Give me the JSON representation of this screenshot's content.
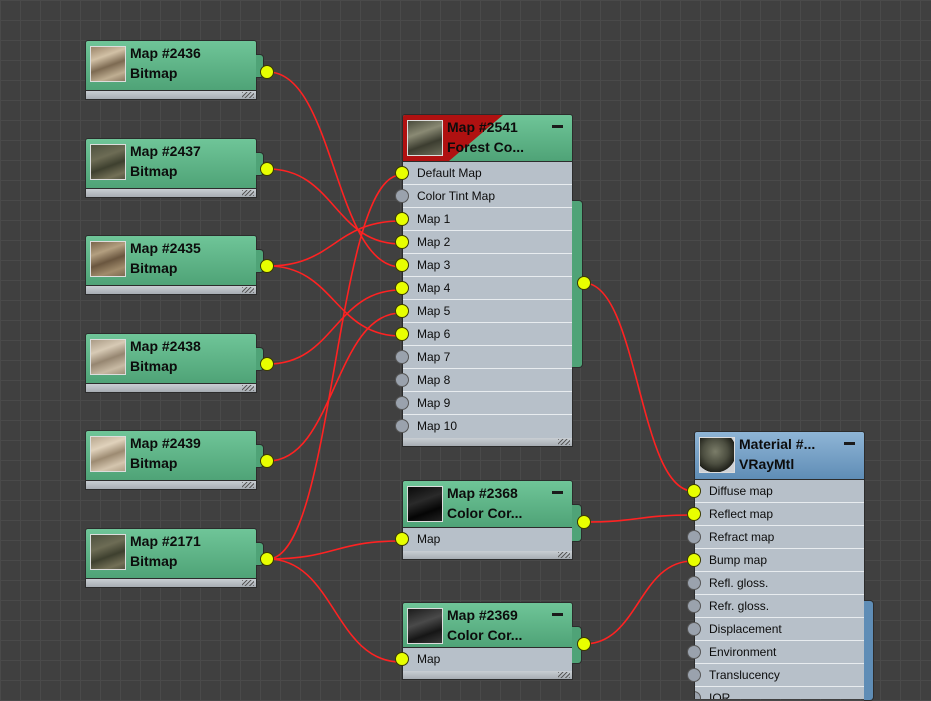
{
  "nodes": {
    "n2436": {
      "name": "Map #2436",
      "type": "Bitmap",
      "thumb": "wood-texture"
    },
    "n2437": {
      "name": "Map #2437",
      "type": "Bitmap",
      "thumb": "wood-texture"
    },
    "n2435": {
      "name": "Map #2435",
      "type": "Bitmap",
      "thumb": "wood-texture"
    },
    "n2438": {
      "name": "Map #2438",
      "type": "Bitmap",
      "thumb": "wood-texture"
    },
    "n2439": {
      "name": "Map #2439",
      "type": "Bitmap",
      "thumb": "wood-texture"
    },
    "n2171": {
      "name": "Map #2171",
      "type": "Bitmap",
      "thumb": "wood-texture"
    },
    "n2541": {
      "name": "Map #2541",
      "type": "Forest Co...",
      "slots": [
        "Default Map",
        "Color Tint Map",
        "Map 1",
        "Map 2",
        "Map 3",
        "Map 4",
        "Map 5",
        "Map 6",
        "Map 7",
        "Map 8",
        "Map 9",
        "Map 10"
      ],
      "connected": [
        true,
        false,
        true,
        true,
        true,
        true,
        true,
        true,
        false,
        false,
        false,
        false
      ]
    },
    "n2368": {
      "name": "Map #2368",
      "type": "Color Cor...",
      "slots": [
        "Map"
      ]
    },
    "n2369": {
      "name": "Map #2369",
      "type": "Color Cor...",
      "slots": [
        "Map"
      ]
    },
    "material": {
      "name": "Material #...",
      "type": "VRayMtl",
      "slots": [
        "Diffuse map",
        "Reflect map",
        "Refract map",
        "Bump map",
        "Refl. gloss.",
        "Refr. gloss.",
        "Displacement",
        "Environment",
        "Translucency",
        "IOR"
      ],
      "connected": [
        true,
        true,
        false,
        true,
        false,
        false,
        false,
        false,
        false,
        false
      ]
    }
  },
  "connections": [
    {
      "from": "n2436",
      "to": "n2541",
      "slot": "Map 3"
    },
    {
      "from": "n2437",
      "to": "n2541",
      "slot": "Map 2"
    },
    {
      "from": "n2435",
      "to": "n2541",
      "slot": "Map 1"
    },
    {
      "from": "n2435",
      "to": "n2541",
      "slot": "Map 6"
    },
    {
      "from": "n2438",
      "to": "n2541",
      "slot": "Map 4"
    },
    {
      "from": "n2439",
      "to": "n2541",
      "slot": "Map 5"
    },
    {
      "from": "n2171",
      "to": "n2541",
      "slot": "Default Map"
    },
    {
      "from": "n2171",
      "to": "n2368",
      "slot": "Map"
    },
    {
      "from": "n2171",
      "to": "n2369",
      "slot": "Map"
    },
    {
      "from": "n2541",
      "to": "material",
      "slot": "Diffuse map"
    },
    {
      "from": "n2368",
      "to": "material",
      "slot": "Reflect map"
    },
    {
      "from": "n2369",
      "to": "material",
      "slot": "Bump map"
    }
  ],
  "colors": {
    "wire": "#ff2222",
    "port_active": "#e8ff00",
    "port_inactive": "#9aa2ad",
    "map_header": "#4fa377",
    "material_header": "#5f8db6",
    "error_corner": "#b01111"
  }
}
